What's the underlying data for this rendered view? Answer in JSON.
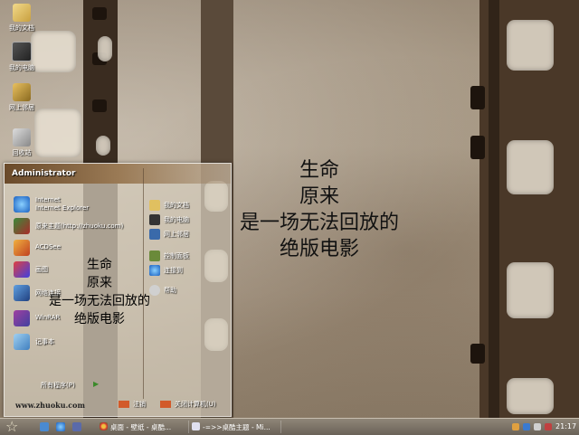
{
  "desktop": {
    "icons": [
      {
        "label": "我的文档",
        "icon": "folder-documents-icon"
      },
      {
        "label": "我的电脑",
        "icon": "computer-icon"
      },
      {
        "label": "网上邻居",
        "icon": "network-icon"
      },
      {
        "label": "回收站",
        "icon": "recycle-bin-icon"
      }
    ],
    "wallpaper_text": [
      "生命",
      "原来",
      "是一场无法回放的",
      "绝版电影"
    ]
  },
  "start_menu": {
    "user": "Administrator",
    "left_items": [
      {
        "line1": "Internet",
        "line2": "Internet Explorer",
        "icon": "internet-explorer-icon"
      },
      {
        "line1": "原来主题(http://zhuoku.com)",
        "line2": "",
        "icon": "theme-icon"
      },
      {
        "line1": "ACDSee",
        "line2": "",
        "icon": "acdsee-icon"
      },
      {
        "line1": "画图",
        "line2": "",
        "icon": "paint-icon"
      },
      {
        "line1": "网络连接",
        "line2": "",
        "icon": "network-connection-icon"
      },
      {
        "line1": "WinRAR",
        "line2": "",
        "icon": "winrar-icon"
      },
      {
        "line1": "记事本",
        "line2": "",
        "icon": "notepad-icon"
      }
    ],
    "right_items": [
      {
        "label": "我的文档",
        "icon": "folder-documents-icon"
      },
      {
        "label": "我的电脑",
        "icon": "computer-icon"
      },
      {
        "label": "网上邻居",
        "icon": "network-icon"
      },
      {
        "label": "控制面板",
        "icon": "control-panel-icon"
      },
      {
        "label": "连接到",
        "icon": "connect-icon"
      },
      {
        "label": "帮助",
        "icon": "help-icon"
      }
    ],
    "all_programs": "所有程序(P)",
    "overlay_text": [
      "生命",
      "原来",
      "是一场无法回放的",
      "绝版电影"
    ],
    "footer_url": "www.zhuoku.com",
    "logoff": "注销",
    "shutdown": "关闭计算机(U)"
  },
  "taskbar": {
    "tasks": [
      {
        "label": "桌面 - 壁纸 - 桌酷...",
        "icon": "chrome-icon"
      },
      {
        "label": "-=>>桌酷主题 - Mi...",
        "icon": "document-icon"
      }
    ],
    "clock": "21:17"
  }
}
